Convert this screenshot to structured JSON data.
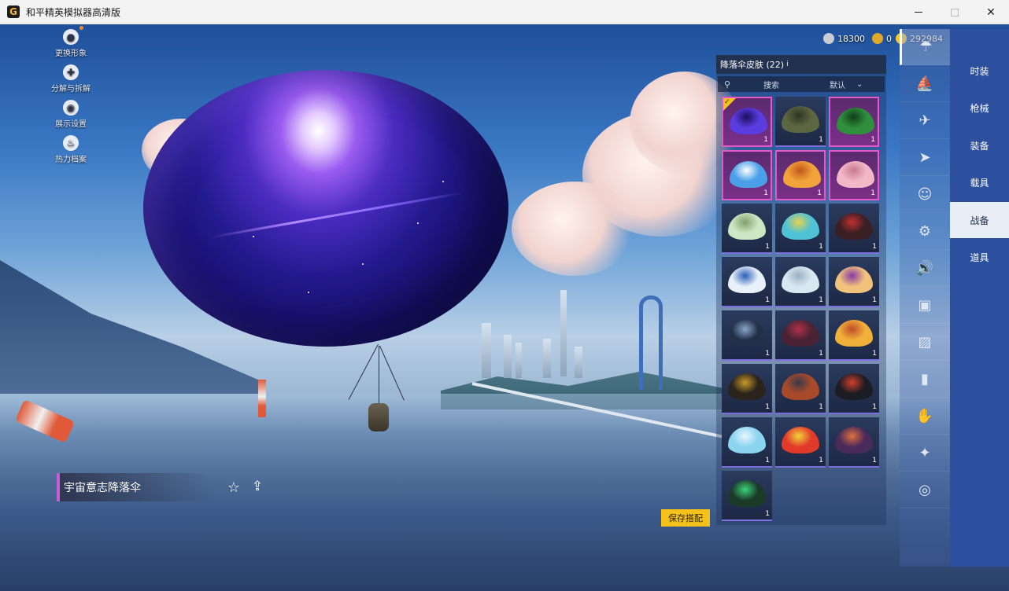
{
  "window": {
    "title": "和平精英模拟器高清版",
    "icon_letter": "G"
  },
  "currency": {
    "silver": "18300",
    "coupon": "0",
    "gold": "292984"
  },
  "left_menu": [
    {
      "label": "更换形象",
      "icon": "avatar-icon"
    },
    {
      "label": "分解与拆解",
      "icon": "puzzle-icon"
    },
    {
      "label": "展示设置",
      "icon": "eye-icon"
    },
    {
      "label": "热力档案",
      "icon": "flame-icon"
    }
  ],
  "panel": {
    "title": "降落伞皮肤 (22)",
    "info": "i",
    "search_label": "搜索",
    "sort_label": "默认"
  },
  "skins": [
    {
      "color": "#5b3ce0",
      "accent": "#1a1160",
      "frame": "pink",
      "selected": true,
      "count": "1"
    },
    {
      "color": "#5c6640",
      "accent": "#2f3424",
      "frame": "normal",
      "count": "1"
    },
    {
      "color": "#2f8f3c",
      "accent": "#0f3d17",
      "frame": "pink",
      "count": "1"
    },
    {
      "color": "#4aa0e8",
      "accent": "#ffffff",
      "frame": "pink",
      "count": "1"
    },
    {
      "color": "#f2a33a",
      "accent": "#c2561d",
      "frame": "pink",
      "count": "1"
    },
    {
      "color": "#f2b8c8",
      "accent": "#c87a90",
      "frame": "pink",
      "count": "1"
    },
    {
      "color": "#cde6c3",
      "accent": "#7fa06c",
      "frame": "normal",
      "count": "1"
    },
    {
      "color": "#4fc2d6",
      "accent": "#e6d34c",
      "frame": "normal",
      "count": "1"
    },
    {
      "color": "#3a1f24",
      "accent": "#c23030",
      "frame": "normal",
      "count": "1"
    },
    {
      "color": "#e8f0fa",
      "accent": "#2c5fb8",
      "frame": "normal",
      "count": "1"
    },
    {
      "color": "#d9e8f0",
      "accent": "#9ab0c4",
      "frame": "normal",
      "count": "1"
    },
    {
      "color": "#f0c27a",
      "accent": "#8a3aa8",
      "frame": "normal",
      "count": "1"
    },
    {
      "color": "#23304a",
      "accent": "#8aa4c8",
      "frame": "normal",
      "count": "1"
    },
    {
      "color": "#4a2434",
      "accent": "#b0304a",
      "frame": "normal",
      "count": "1"
    },
    {
      "color": "#f0b03a",
      "accent": "#c04a2a",
      "frame": "normal",
      "count": "1"
    },
    {
      "color": "#2a241c",
      "accent": "#c89a2a",
      "frame": "normal",
      "count": "1"
    },
    {
      "color": "#a84a2a",
      "accent": "#3a3a4a",
      "frame": "normal",
      "count": "1"
    },
    {
      "color": "#1c1c24",
      "accent": "#d2402a",
      "frame": "normal",
      "count": "1"
    },
    {
      "color": "#8ad4f0",
      "accent": "#e8f6fc",
      "frame": "normal",
      "count": "1"
    },
    {
      "color": "#e23a2a",
      "accent": "#f0d23a",
      "frame": "normal",
      "count": "1"
    },
    {
      "color": "#4a2a5a",
      "accent": "#e0703a",
      "frame": "normal",
      "count": "1"
    },
    {
      "color": "#1c3a28",
      "accent": "#3ad27a",
      "frame": "normal",
      "count": "1"
    }
  ],
  "right_icons": [
    "parachute-icon",
    "boat-icon",
    "plane-icon",
    "jet-icon",
    "face-icon",
    "robot-icon",
    "speaker-icon",
    "chat-icon",
    "photo-icon",
    "spray-icon",
    "hand-icon",
    "wand-icon",
    "ufo-icon"
  ],
  "categories": [
    {
      "label": "时装",
      "active": false
    },
    {
      "label": "枪械",
      "active": false
    },
    {
      "label": "装备",
      "active": false
    },
    {
      "label": "载具",
      "active": false
    },
    {
      "label": "战备",
      "active": true
    },
    {
      "label": "道具",
      "active": false
    }
  ],
  "item": {
    "name": "宇宙意志降落伞"
  },
  "save_button": "保存搭配",
  "colors": {
    "accent_gold": "#f4c21b",
    "category_bg": "#2c4f9e",
    "rare_frame": "#e558c8"
  }
}
